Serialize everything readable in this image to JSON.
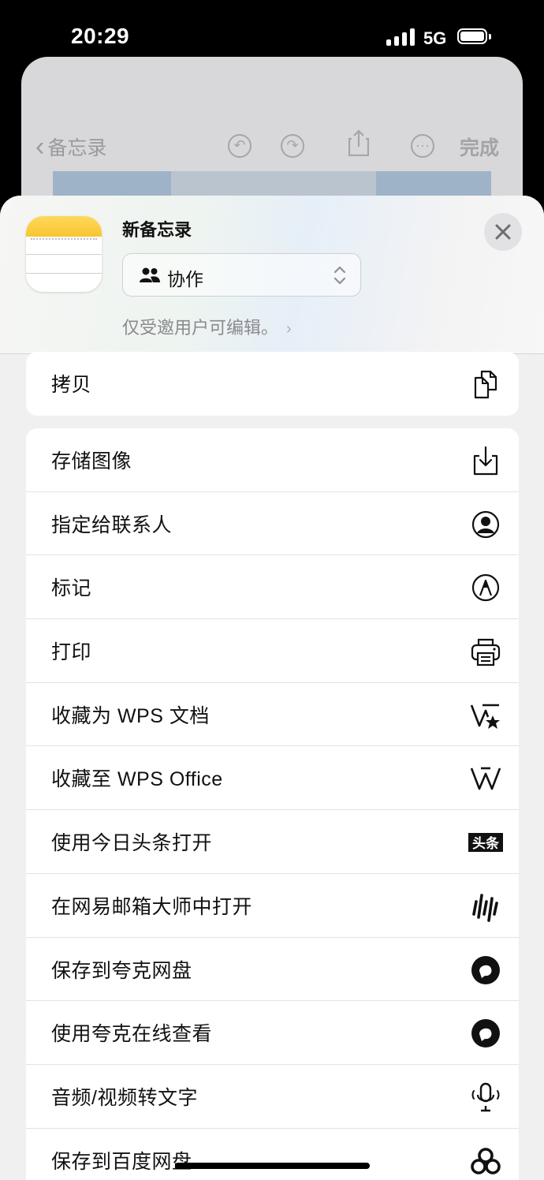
{
  "status_bar": {
    "time": "20:29",
    "network": "5G"
  },
  "background_note": {
    "back_label": "备忘录",
    "done_label": "完成"
  },
  "share_header": {
    "note_title": "新备忘录",
    "collab_label": "协作",
    "permission_text": "仅受邀用户可编辑。",
    "permission_chevron": "›"
  },
  "actions_group1": [
    {
      "label": "拷贝",
      "icon": "copy-icon"
    }
  ],
  "actions_group2": [
    {
      "label": "存储图像",
      "icon": "save-image-icon"
    },
    {
      "label": "指定给联系人",
      "icon": "contact-icon"
    },
    {
      "label": "标记",
      "icon": "markup-icon"
    },
    {
      "label": "打印",
      "icon": "print-icon"
    },
    {
      "label": "收藏为 WPS 文档",
      "icon": "wps-doc-icon"
    },
    {
      "label": "收藏至 WPS Office",
      "icon": "wps-office-icon"
    },
    {
      "label": "使用今日头条打开",
      "icon": "toutiao-icon"
    },
    {
      "label": "在网易邮箱大师中打开",
      "icon": "netease-mail-icon"
    },
    {
      "label": "保存到夸克网盘",
      "icon": "quark-icon"
    },
    {
      "label": "使用夸克在线查看",
      "icon": "quark-view-icon"
    },
    {
      "label": "音频/视频转文字",
      "icon": "microphone-icon"
    },
    {
      "label": "保存到百度网盘",
      "icon": "baidu-netdisk-icon"
    }
  ],
  "toutiao_badge": "头条"
}
